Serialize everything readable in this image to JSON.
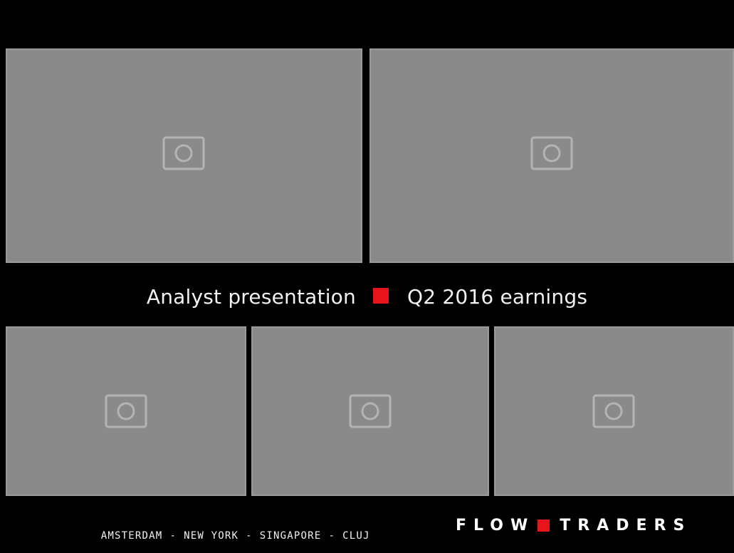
{
  "slide": {
    "title": "Analyst presentation",
    "subtitle": "Q2 2016 earnings",
    "accent_color": "#e8141c",
    "background_color": "#000000"
  },
  "photos": [
    {
      "id": "top-left",
      "icon": "photo-icon"
    },
    {
      "id": "top-right",
      "icon": "photo-icon"
    },
    {
      "id": "bottom-left",
      "icon": "photo-icon"
    },
    {
      "id": "bottom-center",
      "icon": "photo-icon"
    },
    {
      "id": "bottom-right",
      "icon": "photo-icon"
    }
  ],
  "footer": {
    "cities": [
      "AMSTERDAM",
      "NEW YORK",
      "SINGAPORE",
      "CLUJ"
    ],
    "separator": "-",
    "logo_left": "FLOW",
    "logo_right": "TRADERS"
  }
}
